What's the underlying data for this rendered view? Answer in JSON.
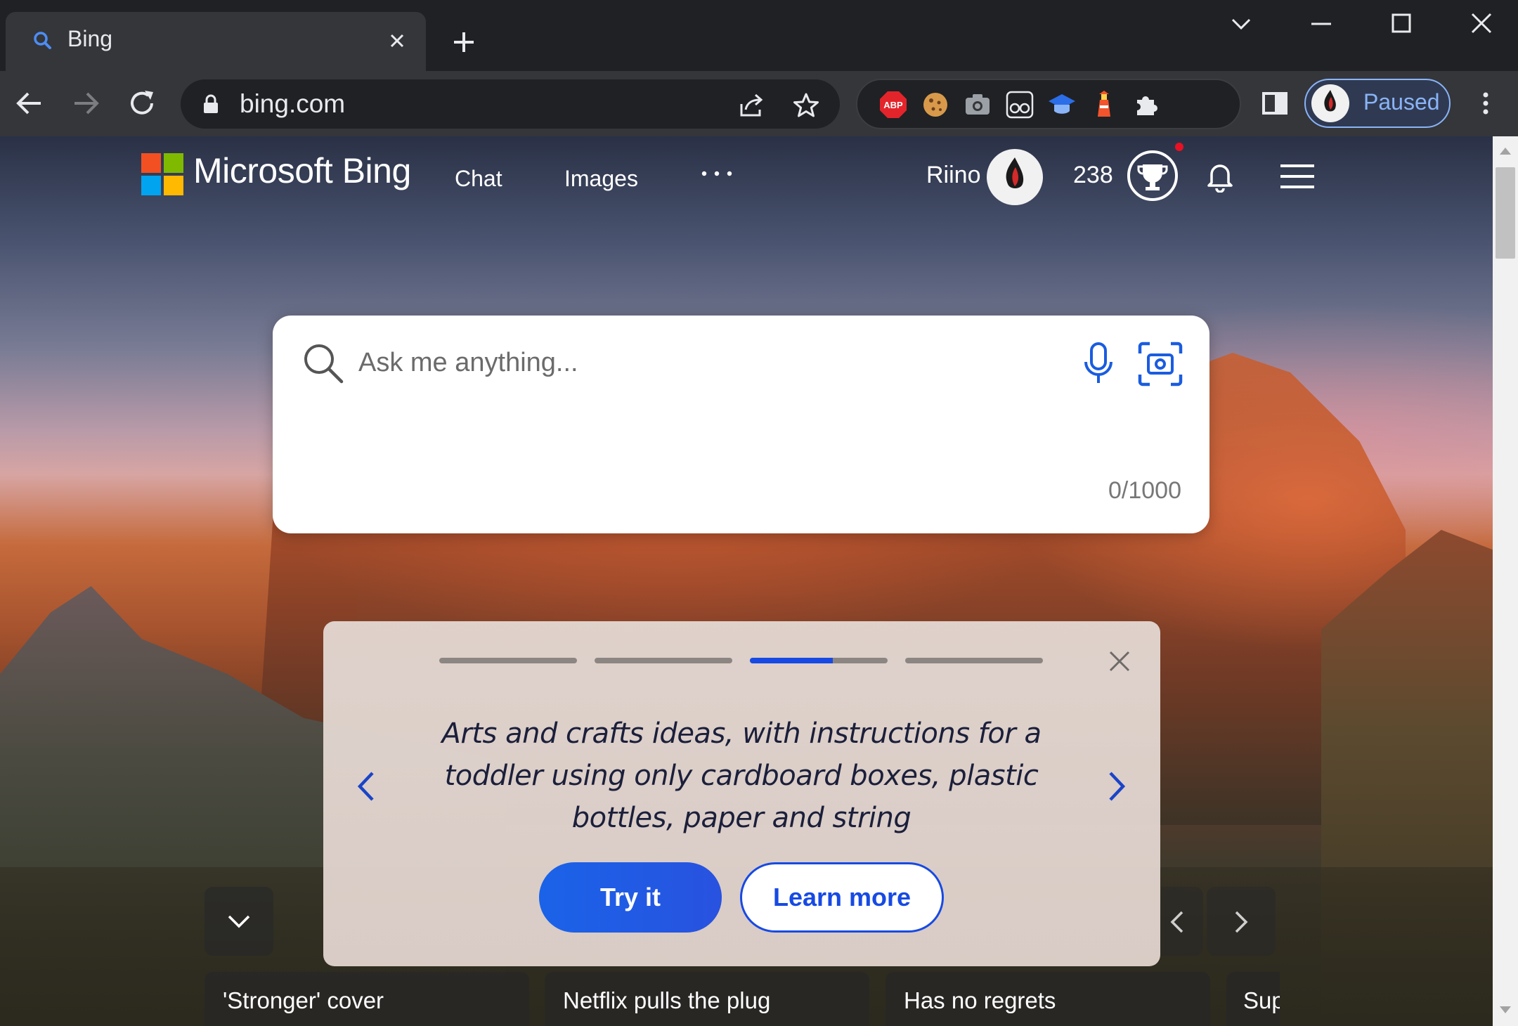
{
  "browser": {
    "tab_title": "Bing",
    "url": "bing.com",
    "profile_status": "Paused",
    "extensions": [
      "adblock-plus-icon",
      "cookie-icon",
      "camera-icon",
      "glasses-icon",
      "graduation-cap-icon",
      "lighthouse-icon",
      "puzzle-icon"
    ]
  },
  "header": {
    "brand": "Microsoft Bing",
    "nav": [
      "Chat",
      "Images"
    ],
    "user_name": "Riino",
    "points": "238"
  },
  "search": {
    "placeholder": "Ask me anything...",
    "char_count": "0/1000"
  },
  "suggestion_card": {
    "progress": [
      1.0,
      1.0,
      0.6,
      0.0
    ],
    "text": "Arts and crafts ideas, with instructions for a toddler using only cardboard boxes, plastic bottles, paper and string",
    "try_label": "Try it",
    "learn_label": "Learn more"
  },
  "news": {
    "items": [
      "'Stronger' cover",
      "Netflix pulls the plug",
      "Has no regrets",
      "Sup"
    ]
  },
  "colors": {
    "accent": "#174ae4",
    "chrome_dark": "#202124",
    "chrome_toolbar": "#35363a",
    "profile_text": "#8ab4f8"
  }
}
